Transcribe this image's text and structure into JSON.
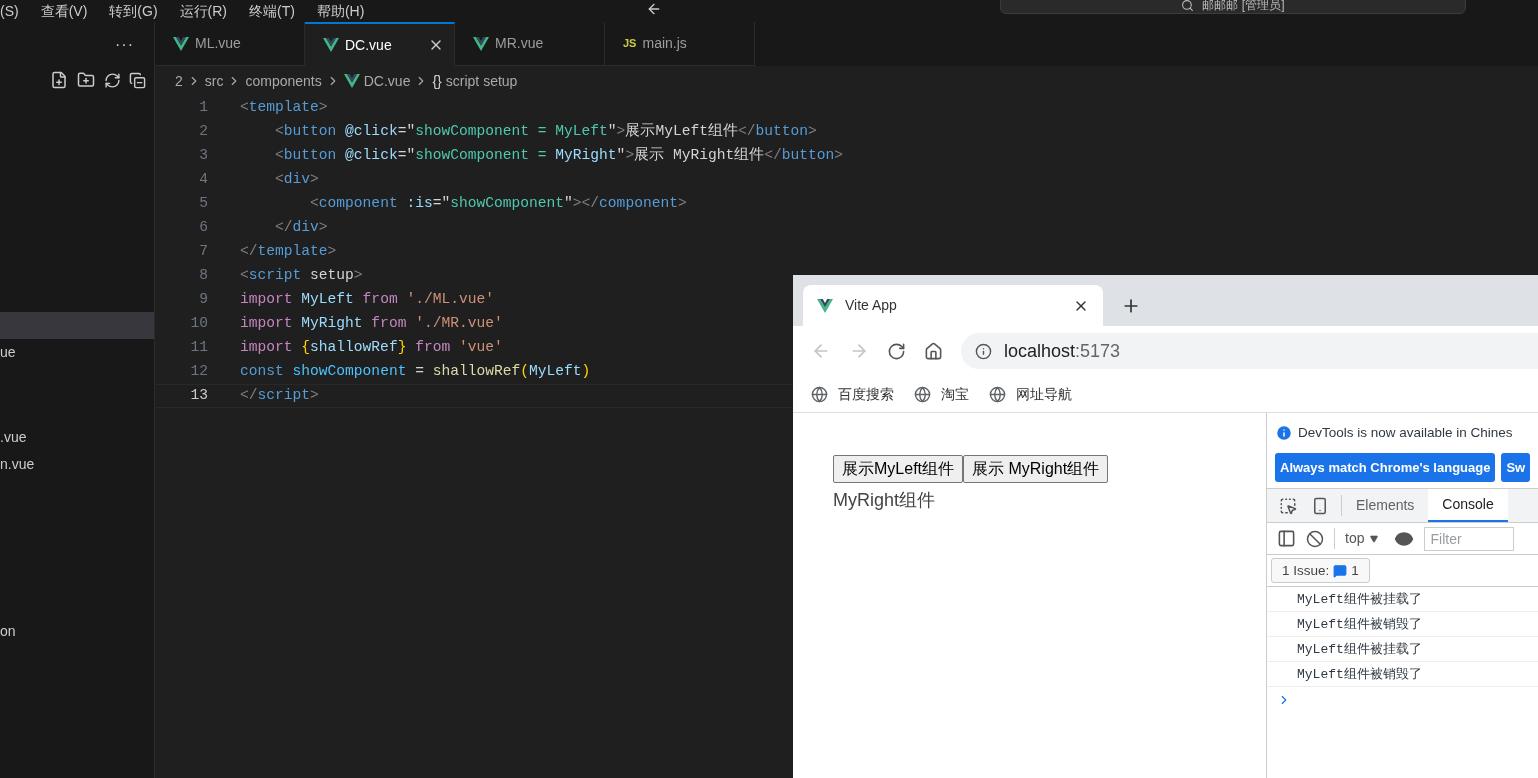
{
  "menu_bar": {
    "items": [
      "(S)",
      "查看(V)",
      "转到(G)",
      "运行(R)",
      "终端(T)",
      "帮助(H)"
    ]
  },
  "title_bar": {
    "search": "邮邮邮 [管理员]"
  },
  "explorer": {
    "more": "···",
    "items": [
      {
        "selected": true
      },
      {
        "label": "ue",
        "selected": false
      },
      {
        "label": ".vue",
        "selected": false
      },
      {
        "label": "n.vue",
        "selected": false
      },
      {
        "label": "on",
        "selected": false
      }
    ]
  },
  "editor_tabs": [
    {
      "label": "ML.vue",
      "kind": "vue",
      "selected": false
    },
    {
      "label": "DC.vue",
      "kind": "vue",
      "selected": true
    },
    {
      "label": "MR.vue",
      "kind": "vue",
      "selected": false
    },
    {
      "label": "main.js",
      "kind": "js",
      "badge": "JS",
      "selected": false
    }
  ],
  "breadcrumb": [
    {
      "label": "2",
      "kind": "plain"
    },
    {
      "label": "src",
      "kind": "plain"
    },
    {
      "label": "components",
      "kind": "plain"
    },
    {
      "label": "DC.vue",
      "kind": "vue"
    },
    {
      "label": "script setup",
      "kind": "braces",
      "badge": "{}"
    }
  ],
  "code": [
    {
      "n": "1",
      "current": false,
      "tokens": [
        {
          "kind": "p",
          "text": "<"
        },
        {
          "kind": "tag",
          "text": "template"
        },
        {
          "kind": "p",
          "text": ">"
        }
      ]
    },
    {
      "n": "2",
      "current": false,
      "tokens": [
        {
          "kind": "p",
          "text": "    <"
        },
        {
          "kind": "tag",
          "text": "button"
        },
        {
          "kind": "attr",
          "text": " @click"
        },
        {
          "kind": "t",
          "text": "=\""
        },
        {
          "kind": "val",
          "text": "showComponent = MyLeft"
        },
        {
          "kind": "t",
          "text": "\""
        },
        {
          "kind": "p",
          "text": ">"
        },
        {
          "kind": "t",
          "text": "展示MyLeft组件"
        },
        {
          "kind": "p",
          "text": "</"
        },
        {
          "kind": "tag",
          "text": "button"
        },
        {
          "kind": "p",
          "text": ">"
        }
      ]
    },
    {
      "n": "3",
      "current": false,
      "tokens": [
        {
          "kind": "p",
          "text": "    <"
        },
        {
          "kind": "tag",
          "text": "button"
        },
        {
          "kind": "attr",
          "text": " @click"
        },
        {
          "kind": "t",
          "text": "=\""
        },
        {
          "kind": "val",
          "text": "showComponent = "
        },
        {
          "kind": "var",
          "text": "MyRight"
        },
        {
          "kind": "t",
          "text": "\""
        },
        {
          "kind": "p",
          "text": ">"
        },
        {
          "kind": "t",
          "text": "展示 MyRight组件"
        },
        {
          "kind": "p",
          "text": "</"
        },
        {
          "kind": "tag",
          "text": "button"
        },
        {
          "kind": "p",
          "text": ">"
        }
      ]
    },
    {
      "n": "4",
      "current": false,
      "tokens": [
        {
          "kind": "p",
          "text": "    <"
        },
        {
          "kind": "tag",
          "text": "div"
        },
        {
          "kind": "p",
          "text": ">"
        }
      ]
    },
    {
      "n": "5",
      "current": false,
      "tokens": [
        {
          "kind": "p",
          "text": "        <"
        },
        {
          "kind": "tag",
          "text": "component"
        },
        {
          "kind": "attr",
          "text": " :is"
        },
        {
          "kind": "t",
          "text": "=\""
        },
        {
          "kind": "val",
          "text": "showComponent"
        },
        {
          "kind": "t",
          "text": "\""
        },
        {
          "kind": "p",
          "text": "></"
        },
        {
          "kind": "tag",
          "text": "component"
        },
        {
          "kind": "p",
          "text": ">"
        }
      ]
    },
    {
      "n": "6",
      "current": false,
      "tokens": [
        {
          "kind": "p",
          "text": "    </"
        },
        {
          "kind": "tag",
          "text": "div"
        },
        {
          "kind": "p",
          "text": ">"
        }
      ]
    },
    {
      "n": "7",
      "current": false,
      "tokens": [
        {
          "kind": "p",
          "text": "</"
        },
        {
          "kind": "tag",
          "text": "template"
        },
        {
          "kind": "p",
          "text": ">"
        }
      ]
    },
    {
      "n": "8",
      "current": false,
      "tokens": [
        {
          "kind": "p",
          "text": "<"
        },
        {
          "kind": "tag",
          "text": "script"
        },
        {
          "kind": "t",
          "text": " setup"
        },
        {
          "kind": "p",
          "text": ">"
        }
      ]
    },
    {
      "n": "9",
      "current": false,
      "tokens": [
        {
          "kind": "kw",
          "text": "import"
        },
        {
          "kind": "var",
          "text": " MyLeft"
        },
        {
          "kind": "kw",
          "text": " from"
        },
        {
          "kind": "str",
          "text": " './ML.vue'"
        }
      ]
    },
    {
      "n": "10",
      "current": false,
      "tokens": [
        {
          "kind": "kw",
          "text": "import"
        },
        {
          "kind": "var",
          "text": " MyRight"
        },
        {
          "kind": "kw",
          "text": " from"
        },
        {
          "kind": "str",
          "text": " './MR.vue'"
        }
      ]
    },
    {
      "n": "11",
      "current": false,
      "tokens": [
        {
          "kind": "kw",
          "text": "import"
        },
        {
          "kind": "brace",
          "text": " {"
        },
        {
          "kind": "var",
          "text": "shallowRef"
        },
        {
          "kind": "brace",
          "text": "}"
        },
        {
          "kind": "kw",
          "text": " from"
        },
        {
          "kind": "str",
          "text": " 'vue'"
        }
      ]
    },
    {
      "n": "12",
      "current": false,
      "tokens": [
        {
          "kind": "decl",
          "text": "const"
        },
        {
          "kind": "const",
          "text": " showComponent"
        },
        {
          "kind": "t",
          "text": " = "
        },
        {
          "kind": "fn",
          "text": "shallowRef"
        },
        {
          "kind": "brace",
          "text": "("
        },
        {
          "kind": "var",
          "text": "MyLeft"
        },
        {
          "kind": "brace",
          "text": ")"
        }
      ]
    },
    {
      "n": "13",
      "current": true,
      "tokens": [
        {
          "kind": "p",
          "text": "</"
        },
        {
          "kind": "tag",
          "text": "script"
        },
        {
          "kind": "p",
          "text": ">"
        }
      ]
    }
  ],
  "browser": {
    "tab": {
      "title": "Vite App"
    },
    "nav": {
      "back_disabled": true,
      "forward_disabled": true
    },
    "address": {
      "host": "localhost",
      "port": ":5173"
    },
    "bookmarks": [
      "百度搜索",
      "淘宝",
      "网址导航"
    ],
    "page": {
      "buttons": [
        "展示MyLeft组件",
        "展示 MyRight组件"
      ],
      "text": "MyRight组件"
    },
    "devtools": {
      "banner": "DevTools is now available in Chines",
      "banner_buttons": [
        "Always match Chrome's language",
        "Sw"
      ],
      "tabs": [
        {
          "label": "Elements",
          "selected": false
        },
        {
          "label": "Console",
          "selected": true
        }
      ],
      "context": "top",
      "filter_placeholder": "Filter",
      "issues": {
        "label": "1 Issue:",
        "count": "1"
      },
      "messages": [
        "MyLeft组件被挂载了",
        "MyLeft组件被销毁了",
        "MyLeft组件被挂载了",
        "MyLeft组件被销毁了"
      ]
    }
  }
}
